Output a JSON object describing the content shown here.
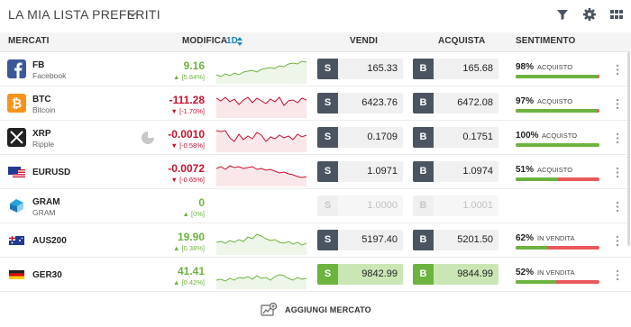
{
  "header": {
    "title": "LA MIA LISTA PREFERITI",
    "icons": [
      "chevron-down-icon",
      "filter-icon",
      "gear-icon",
      "grid-view-icon"
    ]
  },
  "columns": {
    "markets": "MERCATI",
    "change": "MODIFICA",
    "period": "1D",
    "sell": "VENDI",
    "buy": "ACQUISTA",
    "sentiment": "SENTIMENTO"
  },
  "rows": [
    {
      "symbol": "FB",
      "name": "Facebook",
      "icon": "facebook-logo-icon",
      "change": "9.16",
      "pct": "[5.84%]",
      "dir": "up",
      "sell_tag": "S",
      "sell": "165.33",
      "buy_tag": "B",
      "buy": "165.68",
      "sentiment_pct": "98%",
      "sentiment_label": "ACQUISTO",
      "sentiment_value": 98,
      "state": "normal",
      "spark": [
        22,
        24,
        21,
        23,
        20,
        22,
        19,
        18,
        17,
        19,
        16,
        15,
        14,
        15,
        12,
        13,
        10,
        9,
        10,
        7,
        8
      ]
    },
    {
      "symbol": "BTC",
      "name": "Bitcoin",
      "icon": "bitcoin-logo-icon",
      "change": "-111.28",
      "pct": "[-1.70%]",
      "dir": "dn",
      "sell_tag": "S",
      "sell": "6423.76",
      "buy_tag": "B",
      "buy": "6472.08",
      "sentiment_pct": "97%",
      "sentiment_label": "ACQUISTO",
      "sentiment_value": 97,
      "state": "normal",
      "spark": [
        10,
        13,
        9,
        14,
        11,
        17,
        12,
        9,
        15,
        10,
        13,
        16,
        11,
        14,
        9,
        18,
        13,
        12,
        15,
        10,
        12
      ]
    },
    {
      "symbol": "XRP",
      "name": "Ripple",
      "icon": "ripple-logo-icon",
      "change": "-0.0010",
      "pct": "[-0.58%]",
      "dir": "dn",
      "sell_tag": "S",
      "sell": "0.1709",
      "buy_tag": "B",
      "buy": "0.1751",
      "sentiment_pct": "100%",
      "sentiment_label": "ACQUISTO",
      "sentiment_value": 100,
      "state": "normal",
      "spark": [
        8,
        9,
        8,
        16,
        20,
        12,
        18,
        14,
        17,
        10,
        13,
        20,
        15,
        17,
        13,
        16,
        14,
        18,
        12,
        15,
        13
      ]
    },
    {
      "symbol": "EURUSD",
      "name": "",
      "icon": "eu-us-flag-icon",
      "change": "-0.0072",
      "pct": "[-0.65%]",
      "dir": "dn",
      "sell_tag": "S",
      "sell": "1.0971",
      "buy_tag": "B",
      "buy": "1.0974",
      "sentiment_pct": "51%",
      "sentiment_label": "ACQUISTO",
      "sentiment_value": 51,
      "state": "normal",
      "spark": [
        12,
        10,
        13,
        9,
        11,
        10,
        12,
        11,
        10,
        13,
        12,
        14,
        13,
        15,
        17,
        16,
        18,
        19,
        21,
        22,
        21
      ]
    },
    {
      "symbol": "GRAM",
      "name": "GRAM",
      "icon": "gram-logo-icon",
      "change": "0",
      "pct": "[0%]",
      "dir": "flat",
      "sell_tag": "S",
      "sell": "1.0000",
      "buy_tag": "B",
      "buy": "1.0001",
      "sentiment_pct": "",
      "sentiment_label": "",
      "sentiment_value": null,
      "state": "disabled",
      "spark": []
    },
    {
      "symbol": "AUS200",
      "name": "",
      "icon": "au-flag-icon",
      "change": "19.90",
      "pct": "[0.38%]",
      "dir": "up",
      "sell_tag": "S",
      "sell": "5197.40",
      "buy_tag": "B",
      "buy": "5201.50",
      "sentiment_pct": "62%",
      "sentiment_label": "IN VENDITA",
      "sentiment_value": 38,
      "state": "normal",
      "spark": [
        18,
        17,
        19,
        16,
        18,
        15,
        17,
        12,
        14,
        9,
        11,
        14,
        16,
        15,
        18,
        19,
        17,
        20,
        18,
        21,
        19
      ]
    },
    {
      "symbol": "GER30",
      "name": "",
      "icon": "de-flag-icon",
      "change": "41.41",
      "pct": "[0.42%]",
      "dir": "up",
      "sell_tag": "S",
      "sell": "9842.99",
      "buy_tag": "B",
      "buy": "9844.99",
      "sentiment_pct": "52%",
      "sentiment_label": "IN VENDITA",
      "sentiment_value": 48,
      "state": "highlight",
      "spark": [
        22,
        21,
        23,
        20,
        22,
        19,
        20,
        18,
        21,
        17,
        20,
        19,
        22,
        18,
        16,
        17,
        20,
        22,
        19,
        21,
        20
      ]
    }
  ],
  "footer": {
    "add_label": "AGGIUNGI MERCATO"
  },
  "colors": {
    "up": "#6db33f",
    "down": "#c8102e",
    "accent": "#1a86c8",
    "sell_bar": "#e9595a"
  }
}
